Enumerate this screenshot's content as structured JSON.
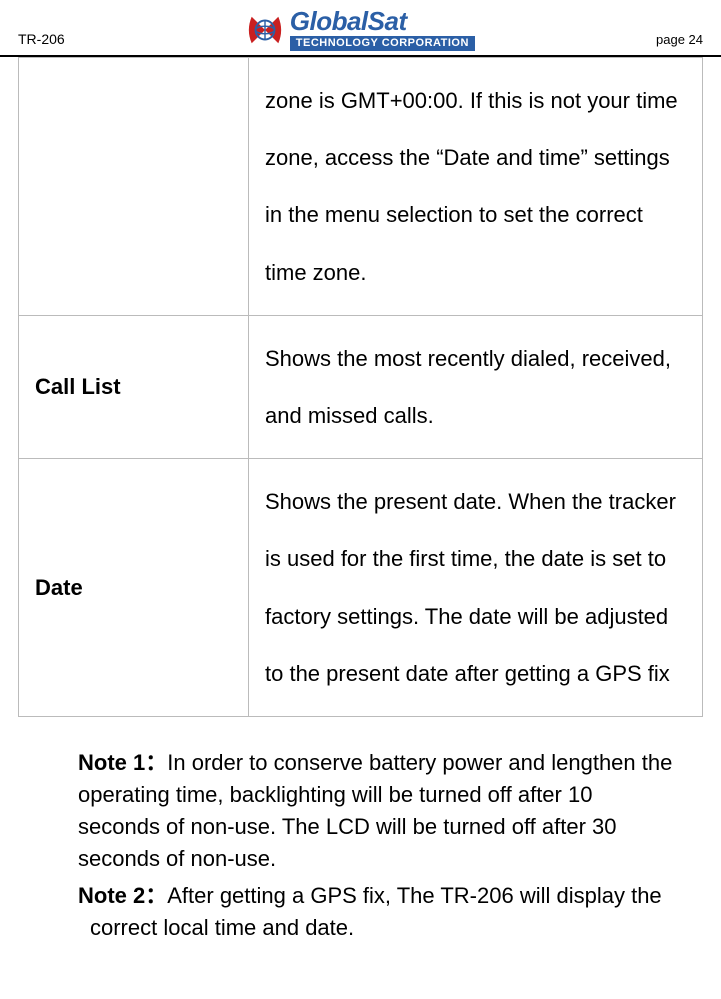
{
  "header": {
    "doc_code": "TR-206",
    "logo_main": "GlobalSat",
    "logo_sub": "TECHNOLOGY CORPORATION",
    "page_label": "page 24"
  },
  "table": {
    "rows": [
      {
        "label": "",
        "desc": "zone is GMT+00:00. If this is not your time zone, access the “Date and time” settings in the menu selection to set the correct time zone."
      },
      {
        "label": "Call List",
        "desc": "Shows the most recently dialed, received, and missed calls."
      },
      {
        "label": "Date",
        "desc": "Shows the present date. When the tracker is used for the first time, the date is set to factory settings. The date will be adjusted to the present date after getting a GPS fix"
      }
    ]
  },
  "notes": {
    "note1_label": "Note 1：",
    "note1_text": "In order to conserve battery power and lengthen the operating time, backlighting will be turned off after 10 seconds of non-use. The LCD will be turned off after 30 seconds of non-use.",
    "note2_label": "Note 2：",
    "note2_text": "After getting a GPS fix, The TR-206 will display the correct local time and date."
  }
}
